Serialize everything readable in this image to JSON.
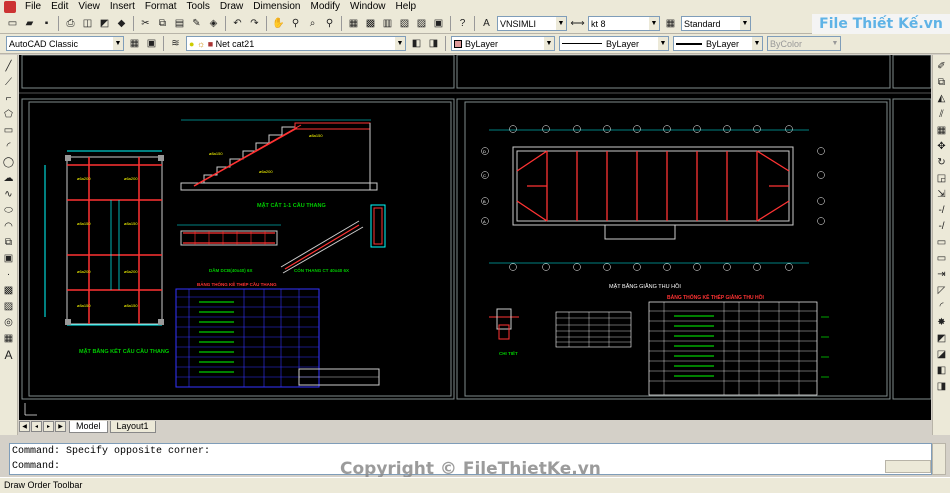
{
  "menu": [
    "File",
    "Edit",
    "View",
    "Insert",
    "Format",
    "Tools",
    "Draw",
    "Dimension",
    "Modify",
    "Window",
    "Help"
  ],
  "toolbar1": {
    "text_style": "VNSIMLI",
    "dim_style": "kt 8",
    "table_style": "Standard"
  },
  "toolbar2": {
    "workspace": "AutoCAD Classic",
    "layer": "Net cat21",
    "color": "ByLayer",
    "linetype": "ByLayer",
    "lineweight": "ByLayer",
    "plotstyle": "ByColor"
  },
  "brand": "File Thiết Kế.vn",
  "drawing": {
    "titles": {
      "floor_plan": "MẶT BẰNG KẾT CẤU CẦU THANG",
      "section": "MẶT CẮT 1-1 CẦU THANG",
      "beam1": "DẦM DCB(40x40) 6X",
      "beam2": "CỐN THANG CT 40x40 6X",
      "stair_table": "BẢNG THỐNG KÊ THÉP CẦU THANG",
      "roof_plan": "MẶT BẰNG GIẰNG THU HỒI",
      "truss_table": "BẢNG THỐNG KÊ THÉP GIẰNG THU HỒI",
      "detail": "CHI TIẾT"
    },
    "grid_labels": [
      "A",
      "B",
      "C",
      "D"
    ]
  },
  "tabs": [
    "Model",
    "Layout1"
  ],
  "command_lines": [
    "Command: Specify opposite corner:",
    "Command:"
  ],
  "watermark": "Copyright © FileThietKe.vn",
  "status": "Draw Order Toolbar",
  "colors": {
    "canvas": "#000000",
    "frame": "#7f8c8d",
    "cyan": "#00ffff",
    "red": "#ff3333",
    "yellow": "#ffff00",
    "green": "#00cc00",
    "magenta": "#ff00ff",
    "white": "#ffffff"
  }
}
